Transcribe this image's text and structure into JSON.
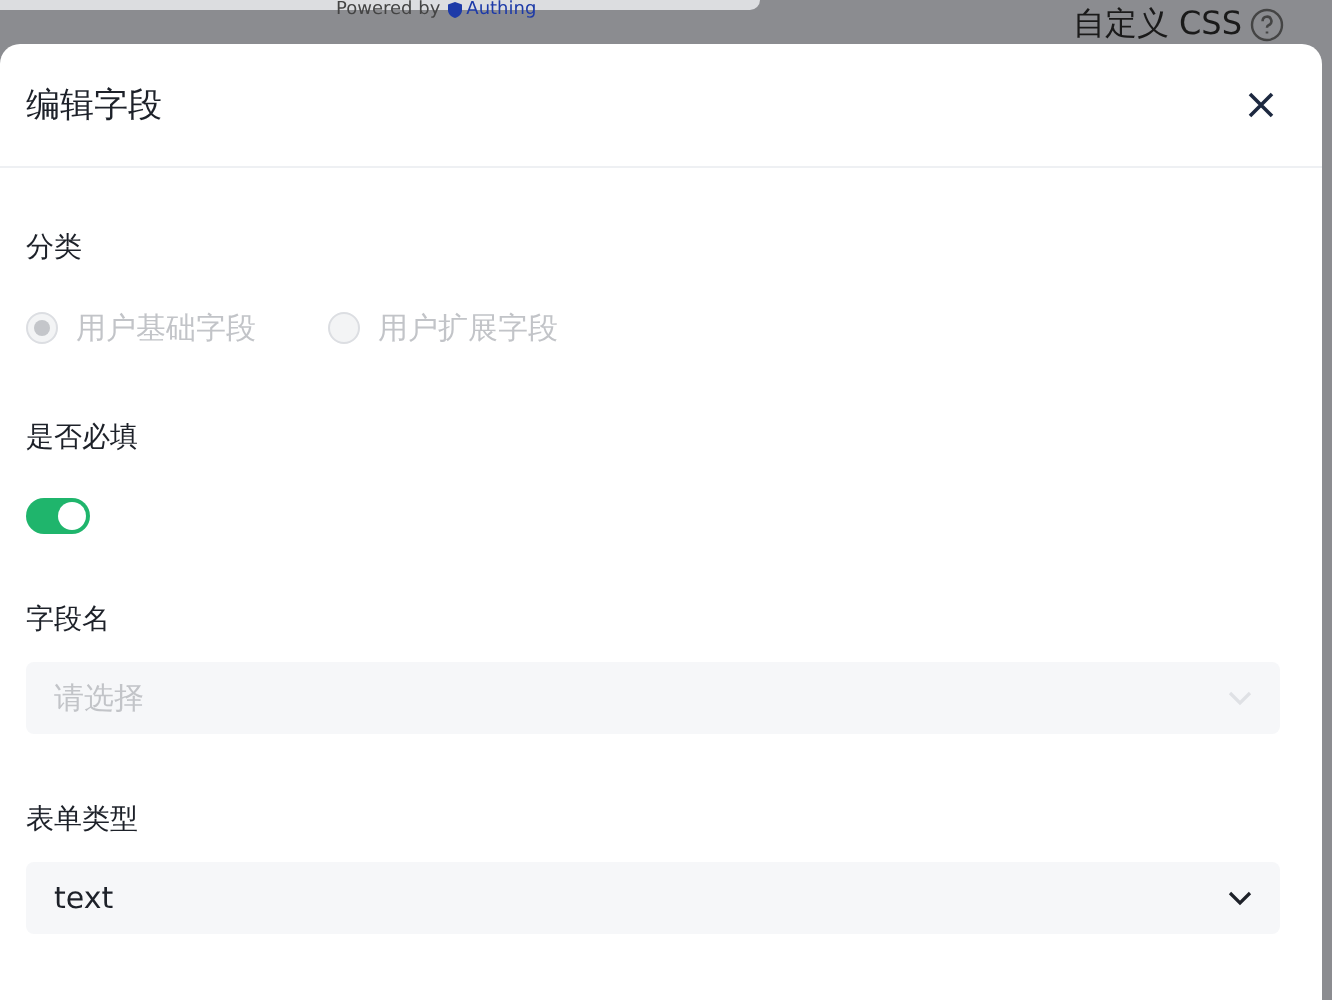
{
  "background": {
    "powered_by": "Powered by",
    "brand": "Authing",
    "custom_css": "自定义 CSS"
  },
  "drawer": {
    "title": "编辑字段"
  },
  "fields": [
    {
      "kind": "radio",
      "label": "分类",
      "disabled": true,
      "options": [
        {
          "label": "用户基础字段",
          "selected": true
        },
        {
          "label": "用户扩展字段",
          "selected": false
        }
      ]
    },
    {
      "kind": "switch",
      "label": "是否必填",
      "on": true
    },
    {
      "kind": "select",
      "label": "字段名",
      "placeholder": "请选择",
      "disabled": true
    },
    {
      "kind": "select",
      "label": "表单类型",
      "value": "text",
      "disabled": false
    }
  ]
}
